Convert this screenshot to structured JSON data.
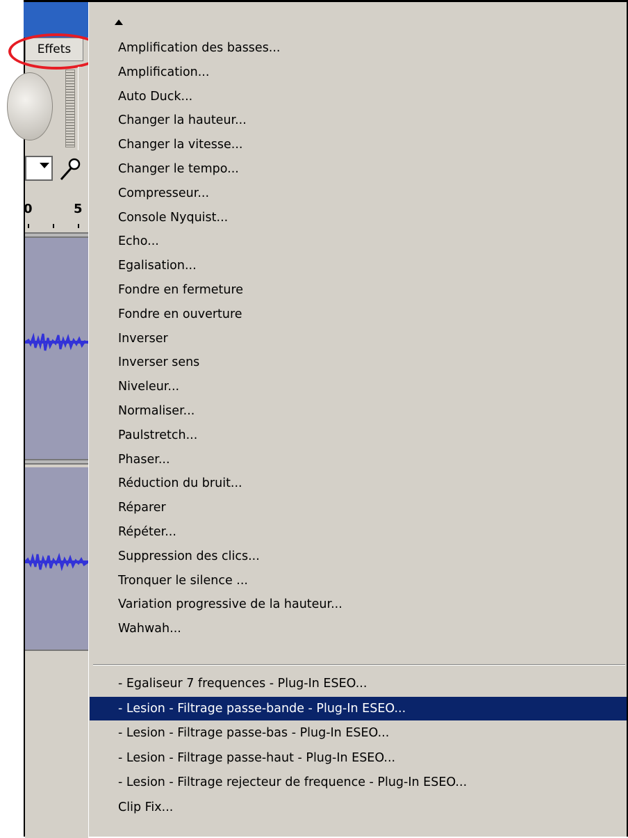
{
  "menubar": {
    "effects_label": "Effets"
  },
  "ruler": {
    "labels": [
      "0",
      "5"
    ]
  },
  "effects_menu": {
    "scroll_up_icon": "triangle-up-icon",
    "items": [
      {
        "label": "Amplification des basses..."
      },
      {
        "label": "Amplification..."
      },
      {
        "label": "Auto Duck..."
      },
      {
        "label": "Changer la hauteur..."
      },
      {
        "label": "Changer la vitesse..."
      },
      {
        "label": "Changer le tempo..."
      },
      {
        "label": "Compresseur..."
      },
      {
        "label": "Console Nyquist..."
      },
      {
        "label": "Echo..."
      },
      {
        "label": "Egalisation..."
      },
      {
        "label": "Fondre en fermeture"
      },
      {
        "label": "Fondre en ouverture"
      },
      {
        "label": "Inverser"
      },
      {
        "label": "Inverser sens"
      },
      {
        "label": "Niveleur..."
      },
      {
        "label": "Normaliser..."
      },
      {
        "label": "Paulstretch..."
      },
      {
        "label": "Phaser..."
      },
      {
        "label": "Réduction du bruit..."
      },
      {
        "label": "Réparer"
      },
      {
        "label": "Répéter..."
      },
      {
        "label": "Suppression des clics..."
      },
      {
        "label": "Tronquer le silence ..."
      },
      {
        "label": "Variation progressive de la hauteur..."
      },
      {
        "label": "Wahwah..."
      }
    ],
    "plugin_items": [
      {
        "label": "- Egaliseur 7 frequences - Plug-In ESEO..."
      },
      {
        "label": "- Lesion - Filtrage passe-bande - Plug-In ESEO...",
        "selected": true
      },
      {
        "label": "- Lesion - Filtrage passe-bas - Plug-In ESEO..."
      },
      {
        "label": "- Lesion - Filtrage passe-haut - Plug-In ESEO..."
      },
      {
        "label": "- Lesion - Filtrage rejecteur de frequence - Plug-In ESEO..."
      },
      {
        "label": "Clip Fix..."
      }
    ]
  },
  "colors": {
    "menu_bg": "#d4d0c8",
    "selection": "#0a246a",
    "highlight_ring": "#e61c24",
    "waveform": "#3232d8"
  }
}
